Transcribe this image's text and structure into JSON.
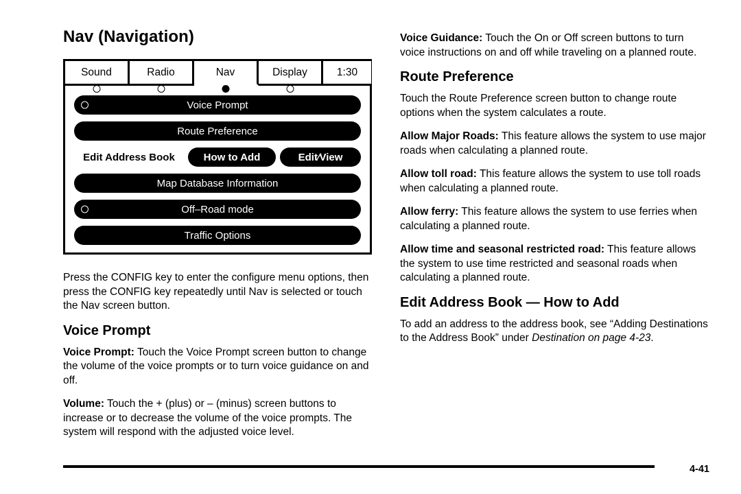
{
  "left": {
    "title": "Nav (Navigation)",
    "screen": {
      "tabs": [
        {
          "label": "Sound",
          "active": false,
          "dot": "hollow"
        },
        {
          "label": "Radio",
          "active": false,
          "dot": "hollow"
        },
        {
          "label": "Nav",
          "active": true,
          "dot": "filled"
        },
        {
          "label": "Display",
          "active": false,
          "dot": "hollow"
        },
        {
          "label": "1:30",
          "active": false,
          "dot": "none"
        }
      ],
      "buttons": {
        "voice_prompt": "Voice Prompt",
        "route_preference": "Route Preference",
        "edit_address_book": "Edit Address Book",
        "how_to_add": "How to Add",
        "edit_view": "Edit∕View",
        "map_database_information": "Map Database Information",
        "off_road_mode": "Off–Road mode",
        "traffic_options": "Traffic Options"
      }
    },
    "intro_paragraph": "Press the CONFIG key to enter the configure menu options, then press the CONFIG key repeatedly until Nav is selected or touch the Nav screen button.",
    "voice_prompt_heading": "Voice Prompt",
    "voice_prompt_lead": "Voice Prompt:",
    "voice_prompt_text": " Touch the Voice Prompt screen button to change the volume of the voice prompts or to turn voice guidance on and off.",
    "volume_lead": "Volume:",
    "volume_text": " Touch the + (plus) or – (minus) screen buttons to increase or to decrease the volume of the voice prompts. The system will respond with the adjusted voice level."
  },
  "right": {
    "voice_guidance_lead": "Voice Guidance:",
    "voice_guidance_text": " Touch the On or Off screen buttons to turn voice instructions on and off while traveling on a planned route.",
    "route_preference_heading": "Route Preference",
    "route_preference_text": "Touch the Route Preference screen button to change route options when the system calculates a route.",
    "allow_major_roads_lead": "Allow Major Roads:",
    "allow_major_roads_text": " This feature allows the system to use major roads when calculating a planned route.",
    "allow_toll_road_lead": "Allow toll road:",
    "allow_toll_road_text": " This feature allows the system to use toll roads when calculating a planned route.",
    "allow_ferry_lead": "Allow ferry:",
    "allow_ferry_text": " This feature allows the system to use ferries when calculating a planned route.",
    "allow_time_seasonal_lead": "Allow time and seasonal restricted road:",
    "allow_time_seasonal_text": " This feature allows the system to use time restricted and seasonal roads when calculating a planned route.",
    "edit_address_heading": "Edit Address Book — How to Add",
    "edit_address_text_1": "To add an address to the address book, see “Adding Destinations to the Address Book” under ",
    "edit_address_italic_1": "Destination on page 4-23",
    "edit_address_text_2": "."
  },
  "footer": {
    "page_number": "4-41"
  }
}
